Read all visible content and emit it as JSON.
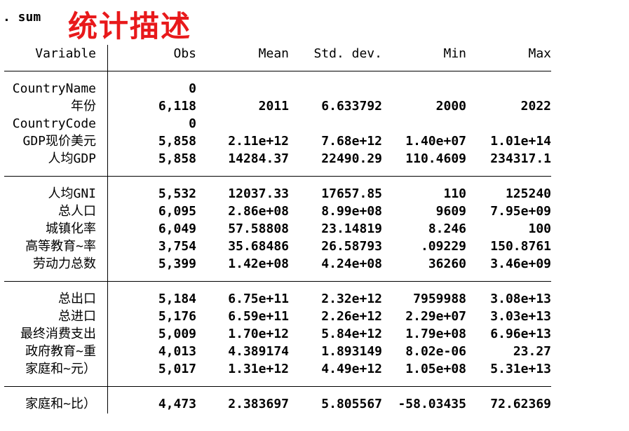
{
  "command": ". sum",
  "heading": "统计描述",
  "heading_color": "#e8191b",
  "table": {
    "headers": [
      "Variable",
      "Obs",
      "Mean",
      "Std. dev.",
      "Min",
      "Max"
    ],
    "rows": [
      {
        "name": "CountryName",
        "obs": "0",
        "mean": "",
        "sd": "",
        "min": "",
        "max": ""
      },
      {
        "name": "年份",
        "obs": "6,118",
        "mean": "2011",
        "sd": "6.633792",
        "min": "2000",
        "max": "2022"
      },
      {
        "name": "CountryCode",
        "obs": "0",
        "mean": "",
        "sd": "",
        "min": "",
        "max": ""
      },
      {
        "name": "GDP现价美元",
        "obs": "5,858",
        "mean": "2.11e+12",
        "sd": "7.68e+12",
        "min": "1.40e+07",
        "max": "1.01e+14"
      },
      {
        "name": "人均GDP",
        "obs": "5,858",
        "mean": "14284.37",
        "sd": "22490.29",
        "min": "110.4609",
        "max": "234317.1"
      },
      {
        "name": "人均GNI",
        "obs": "5,532",
        "mean": "12037.33",
        "sd": "17657.85",
        "min": "110",
        "max": "125240"
      },
      {
        "name": "总人口",
        "obs": "6,095",
        "mean": "2.86e+08",
        "sd": "8.99e+08",
        "min": "9609",
        "max": "7.95e+09"
      },
      {
        "name": "城镇化率",
        "obs": "6,049",
        "mean": "57.58808",
        "sd": "23.14819",
        "min": "8.246",
        "max": "100"
      },
      {
        "name": "高等教育~率",
        "obs": "3,754",
        "mean": "35.68486",
        "sd": "26.58793",
        "min": ".09229",
        "max": "150.8761"
      },
      {
        "name": "劳动力总数",
        "obs": "5,399",
        "mean": "1.42e+08",
        "sd": "4.24e+08",
        "min": "36260",
        "max": "3.46e+09"
      },
      {
        "name": "总出口",
        "obs": "5,184",
        "mean": "6.75e+11",
        "sd": "2.32e+12",
        "min": "7959988",
        "max": "3.08e+13"
      },
      {
        "name": "总进口",
        "obs": "5,176",
        "mean": "6.59e+11",
        "sd": "2.26e+12",
        "min": "2.29e+07",
        "max": "3.03e+13"
      },
      {
        "name": "最终消费支出",
        "obs": "5,009",
        "mean": "1.70e+12",
        "sd": "5.84e+12",
        "min": "1.79e+08",
        "max": "6.96e+13"
      },
      {
        "name": "政府教育~重",
        "obs": "4,013",
        "mean": "4.389174",
        "sd": "1.893149",
        "min": "8.02e-06",
        "max": "23.27"
      },
      {
        "name": "家庭和~元）",
        "obs": "5,017",
        "mean": "1.31e+12",
        "sd": "4.49e+12",
        "min": "1.05e+08",
        "max": "5.31e+13"
      },
      {
        "name": "家庭和~比）",
        "obs": "4,473",
        "mean": "2.383697",
        "sd": "5.805567",
        "min": "-58.03435",
        "max": "72.62369"
      }
    ]
  }
}
